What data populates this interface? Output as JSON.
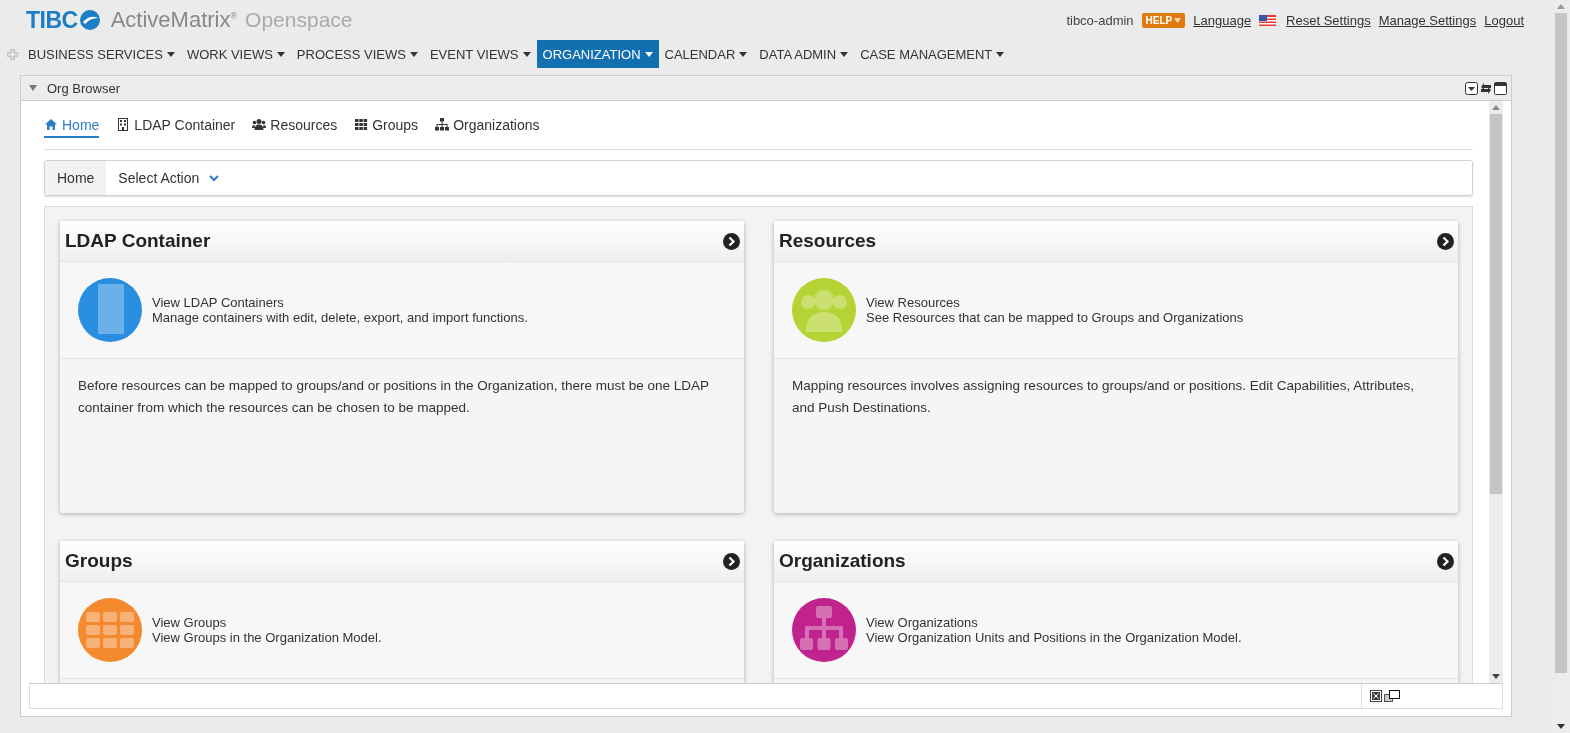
{
  "header": {
    "brand": "TIBC",
    "product": "ActiveMatrix$^{®}$",
    "suite": "Openspace",
    "user": "tibco-admin",
    "help": "HELP",
    "links": [
      {
        "label": "Language",
        "kind": "language"
      },
      {
        "label": "Reset Settings",
        "kind": "plain"
      },
      {
        "label": "Manage Settings",
        "kind": "plain"
      },
      {
        "label": "Logout",
        "kind": "plain"
      }
    ]
  },
  "nav": [
    {
      "label": "BUSINESS SERVICES",
      "selected": false
    },
    {
      "label": "WORK VIEWS",
      "selected": false
    },
    {
      "label": "PROCESS VIEWS",
      "selected": false
    },
    {
      "label": "EVENT VIEWS",
      "selected": false
    },
    {
      "label": "ORGANIZATION",
      "selected": true
    },
    {
      "label": "CALENDAR",
      "selected": false
    },
    {
      "label": "DATA ADMIN",
      "selected": false
    },
    {
      "label": "CASE MANAGEMENT",
      "selected": false
    }
  ],
  "portlet": {
    "title": "Org Browser",
    "tabs": [
      {
        "label": "Home",
        "kind": "home",
        "selected": true
      },
      {
        "label": "LDAP Container",
        "kind": "building",
        "selected": false
      },
      {
        "label": "Resources",
        "kind": "users",
        "selected": false
      },
      {
        "label": "Groups",
        "kind": "grid",
        "selected": false
      },
      {
        "label": "Organizations",
        "kind": "sitemap",
        "selected": false
      }
    ],
    "breadcrumb": "Home",
    "action": "Select Action",
    "cards": [
      {
        "title": "LDAP Container",
        "kind": "building",
        "color": "#2a8ee0",
        "link": "View LDAP Containers",
        "summary": "Manage containers with edit, delete, export, and import functions.",
        "description": "Before resources can be mapped to groups/and or positions in the Organization, there must be one LDAP container from which the resources can be chosen to be mapped."
      },
      {
        "title": "Resources",
        "kind": "users",
        "color": "#b5d334",
        "link": "View Resources",
        "summary": "See Resources that can be mapped to Groups and Organizations",
        "description": "Mapping resources involves assigning resources to groups/and or positions. Edit Capabilities, Attributes, and Push Destinations."
      },
      {
        "title": "Groups",
        "kind": "grid",
        "color": "#f5892e",
        "link": "View Groups",
        "summary": "View Groups in the Organization Model."
      },
      {
        "title": "Organizations",
        "kind": "sitemap",
        "color": "#c0238e",
        "link": "View Organizations",
        "summary": "View Organization Units and Positions in the Organization Model."
      }
    ]
  }
}
